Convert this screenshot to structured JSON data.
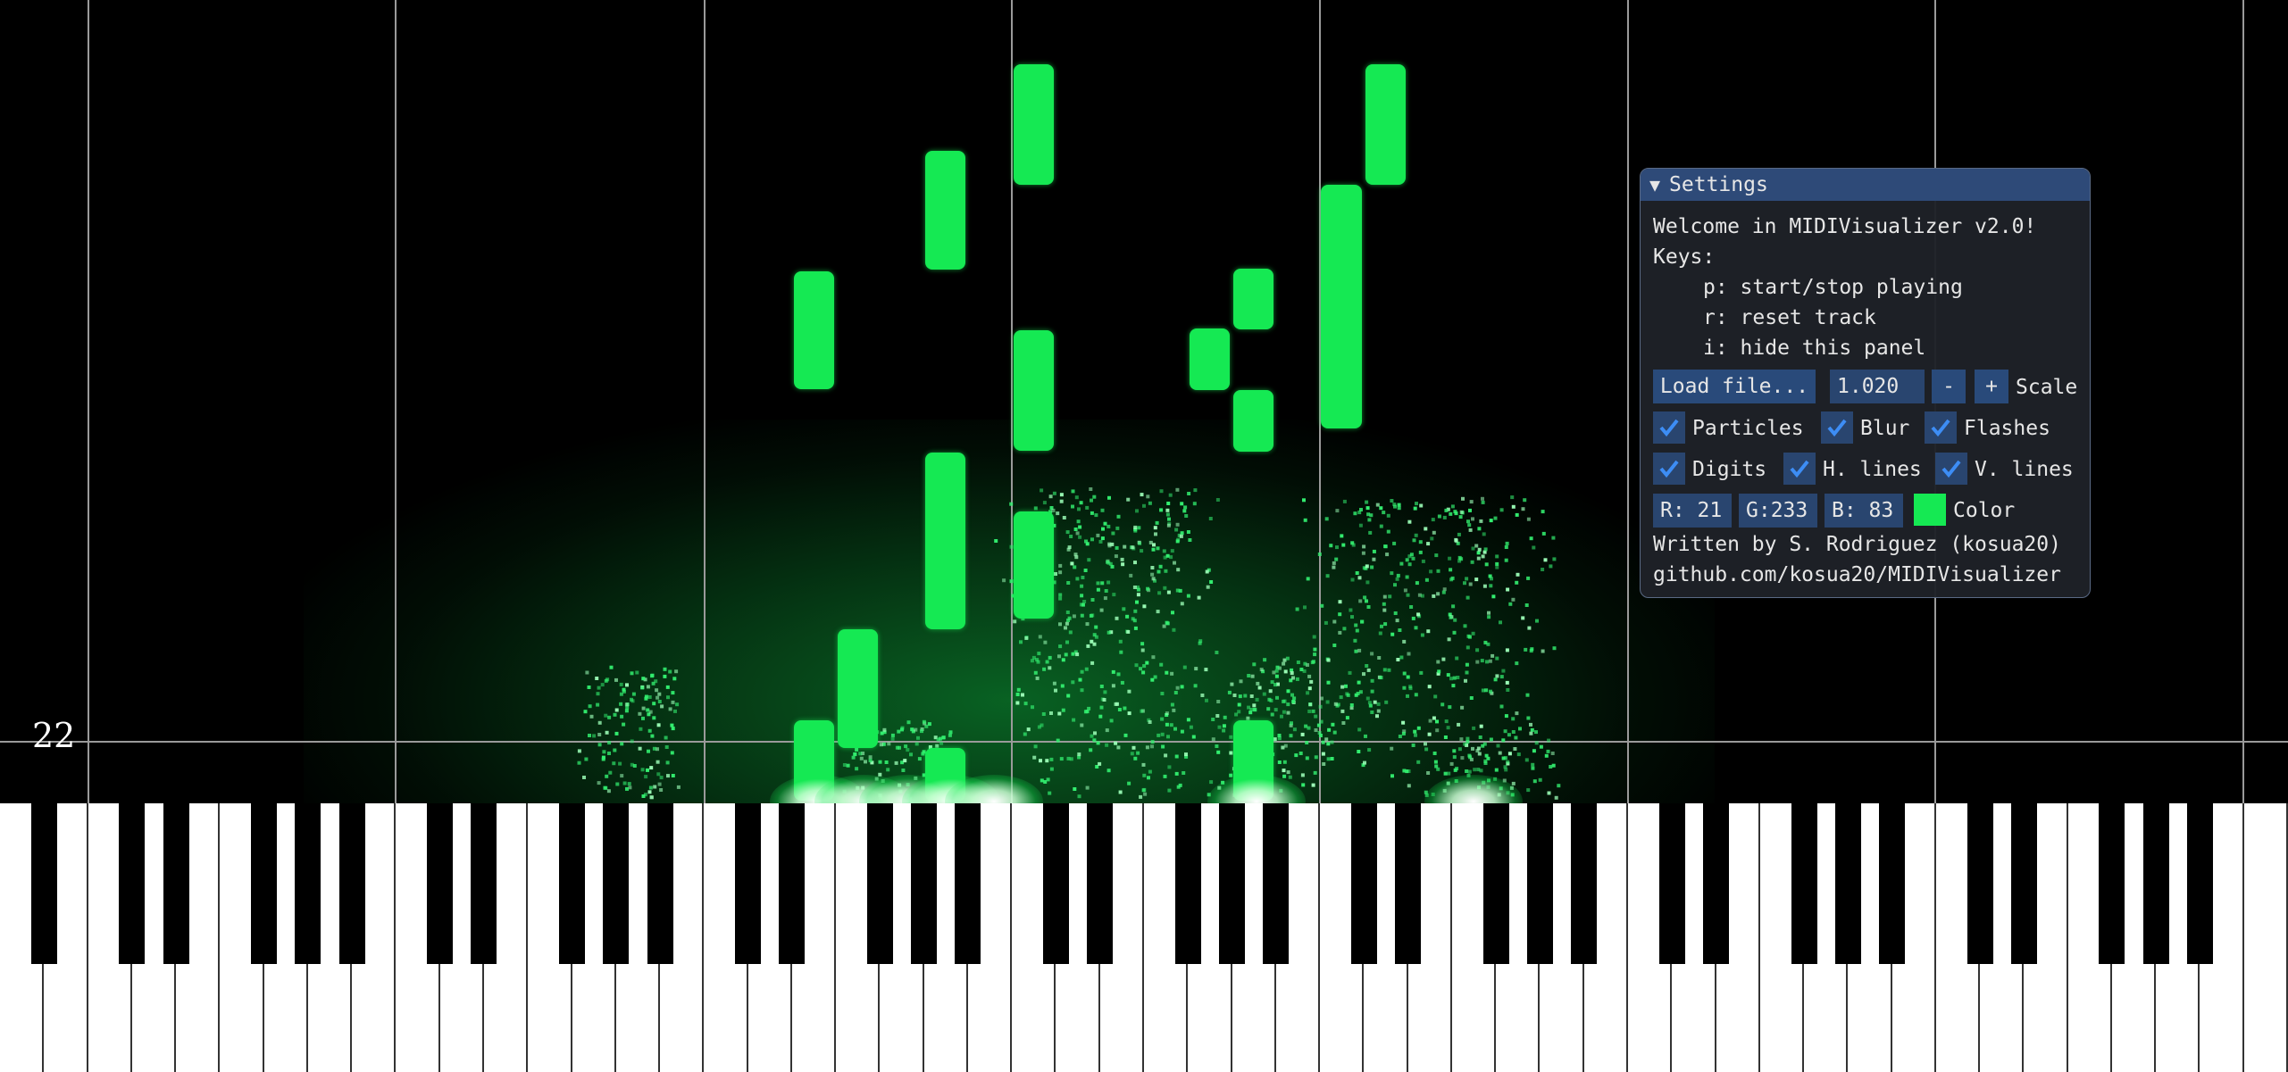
{
  "visualizer": {
    "note_color": "#15e953",
    "digit_label": "22"
  },
  "settings": {
    "title": "Settings",
    "collapse_icon": "triangle-down-icon",
    "welcome": "Welcome in MIDIVisualizer v2.0!",
    "keys_heading": "Keys:",
    "key_p": "p: start/stop playing",
    "key_r": "r: reset track",
    "key_i": "i: hide this panel",
    "load_button": "Load file...",
    "scale_value": "1.020",
    "scale_minus": "-",
    "scale_plus": "+",
    "scale_label": "Scale",
    "options": [
      {
        "label": "Particles",
        "checked": true
      },
      {
        "label": "Blur",
        "checked": true
      },
      {
        "label": "Flashes",
        "checked": true
      },
      {
        "label": "Digits",
        "checked": true
      },
      {
        "label": "H. lines",
        "checked": true
      },
      {
        "label": "V. lines",
        "checked": true
      }
    ],
    "color_r": "R: 21",
    "color_g": "G:233",
    "color_b": "B: 83",
    "color_label": "Color",
    "credit": "Written by S. Rodriguez (kosua20)",
    "url": "github.com/kosua20/MIDIVisualizer"
  }
}
